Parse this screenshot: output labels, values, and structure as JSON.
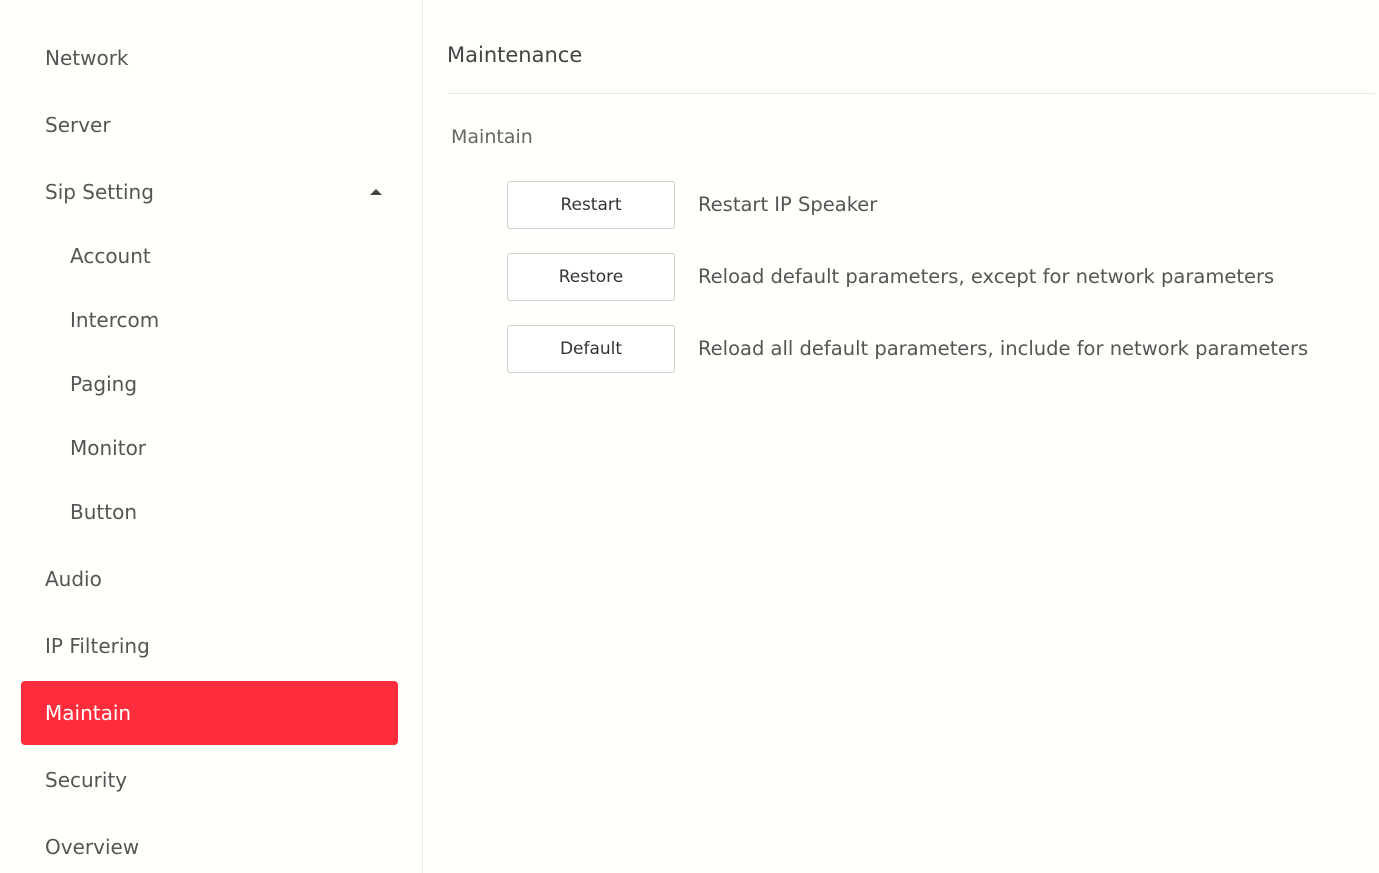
{
  "sidebar": {
    "items": [
      {
        "label": "Network"
      },
      {
        "label": "Server"
      },
      {
        "label": "Sip Setting",
        "expanded": true,
        "caret_icon": "caret-up-icon"
      },
      {
        "label": "Account"
      },
      {
        "label": "Intercom"
      },
      {
        "label": "Paging"
      },
      {
        "label": "Monitor"
      },
      {
        "label": "Button"
      },
      {
        "label": "Audio"
      },
      {
        "label": "IP Filtering"
      },
      {
        "label": "Maintain",
        "active": true
      },
      {
        "label": "Security"
      },
      {
        "label": "Overview"
      }
    ]
  },
  "main": {
    "title": "Maintenance",
    "section_label": "Maintain",
    "actions": [
      {
        "button_label": "Restart",
        "description": "Restart IP Speaker"
      },
      {
        "button_label": "Restore",
        "description": "Reload default parameters, except for network parameters"
      },
      {
        "button_label": "Default",
        "description": "Reload all default parameters, include for network parameters"
      }
    ]
  },
  "colors": {
    "accent": "#ff2d3b",
    "background": "#fffffb",
    "divider": "#e8e8e4"
  }
}
